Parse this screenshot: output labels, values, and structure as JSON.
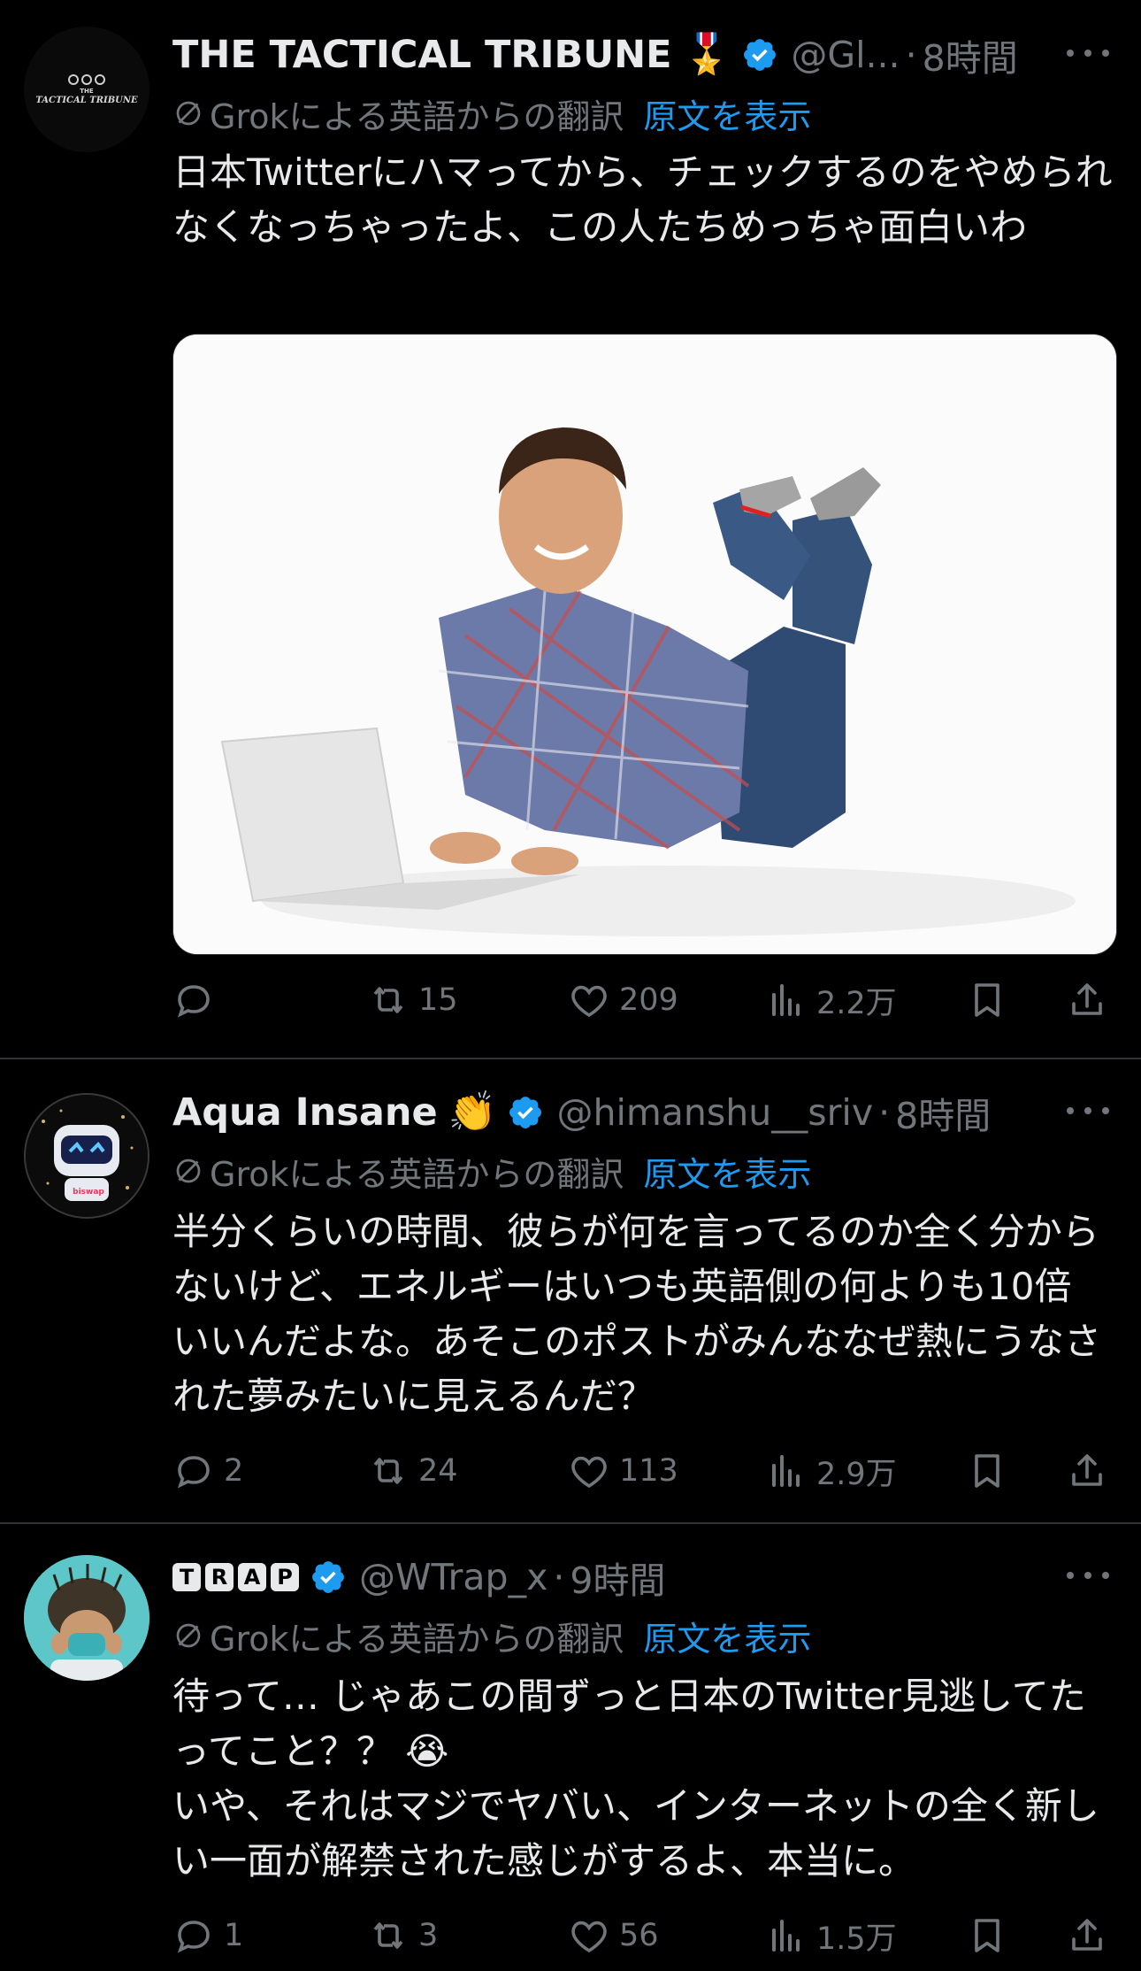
{
  "posts": [
    {
      "name": "THE TACTICAL TRIBUNE",
      "badge_emoji": "🎖️",
      "handle": "@Gl...",
      "separator": "·",
      "time": "8時間",
      "avatar_text_top": "THE",
      "avatar_text_bottom": "TACTICAL TRIBUNE",
      "translation_label": "Grokによる英語からの翻訳",
      "show_original": "原文を表示",
      "text": "日本Twitterにハマってから、チェックするのをやめられなくなっちゃったよ、この人たちめっちゃ面白いわ",
      "counts": {
        "reply": "",
        "repost": "15",
        "like": "209",
        "views": "2.2万"
      }
    },
    {
      "name": "Aqua Insane",
      "badge_emoji": "👏",
      "handle": "@himanshu__sriv",
      "separator": "·",
      "time": "8時間",
      "avatar_text_bottom": "biswap",
      "translation_label": "Grokによる英語からの翻訳",
      "show_original": "原文を表示",
      "text": "半分くらいの時間、彼らが何を言ってるのか全く分からないけど、エネルギーはいつも英語側の何よりも10倍いいんだよな。あそこのポストがみんななぜ熱にうなされた夢みたいに見えるんだ？",
      "counts": {
        "reply": "2",
        "repost": "24",
        "like": "113",
        "views": "2.9万"
      }
    },
    {
      "name_letters": [
        "T",
        "R",
        "A",
        "P"
      ],
      "handle": "@WTrap_x",
      "separator": "·",
      "time": "9時間",
      "translation_label": "Grokによる英語からの翻訳",
      "show_original": "原文を表示",
      "text": "待って… じゃあこの間ずっと日本のTwitter見逃してたってこと？？ 😭\nいや、それはマジでヤバい、インターネットの全く新しい一面が解禁された感じがするよ、本当に。",
      "counts": {
        "reply": "1",
        "repost": "3",
        "like": "56",
        "views": "1.5万"
      }
    }
  ],
  "colors": {
    "background": "#000000",
    "text": "#e7e9ea",
    "muted": "#71767b",
    "link": "#1d9bf0",
    "verified": "#1d9bf0",
    "divider": "#2f3336"
  },
  "icons": {
    "verified": "verified-badge-icon",
    "translate": "translate-slash-icon",
    "reply": "reply-bubble-icon",
    "repost": "repost-arrows-icon",
    "like": "heart-icon",
    "views": "views-bars-icon",
    "bookmark": "bookmark-icon",
    "share": "share-upload-icon",
    "more": "more-dots-icon"
  }
}
